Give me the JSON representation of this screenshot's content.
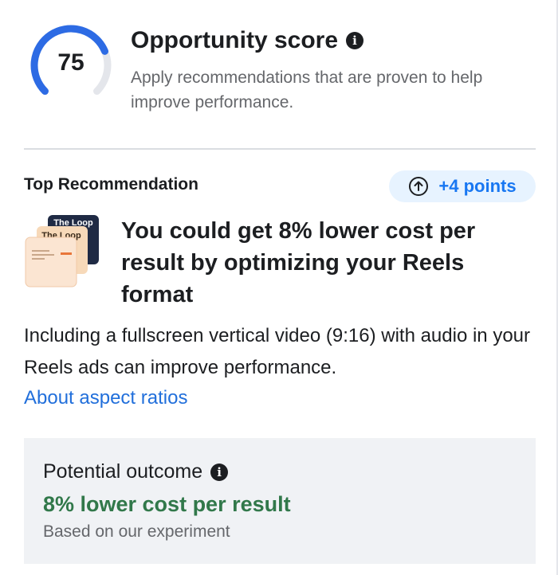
{
  "score": {
    "value": "75",
    "progress_fraction": 0.75,
    "title": "Opportunity score",
    "description": "Apply recommendations that are proven to help improve performance.",
    "accent_color": "#2d6be4",
    "track_color": "#e4e6eb"
  },
  "recommendation": {
    "section_label": "Top Recommendation",
    "points": "+4 points",
    "thumbnail_text": [
      "The Loop",
      "The Loop"
    ],
    "title": "You could get 8% lower cost per result by optimizing your Reels format",
    "body": "Including a fullscreen vertical video (9:16) with audio in your Reels ads can improve performance.",
    "link": "About aspect ratios"
  },
  "outcome": {
    "label": "Potential outcome",
    "value": "8% lower cost per result",
    "note": "Based on our experiment",
    "value_color": "#31784a"
  },
  "icons": {
    "info": "info-icon",
    "points": "arrow-up-circle-icon"
  }
}
